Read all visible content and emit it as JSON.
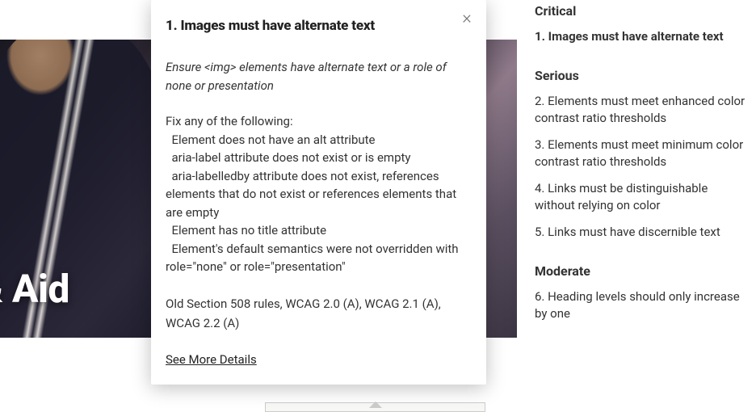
{
  "hero": {
    "title_fragment": "ns & Aid"
  },
  "popup": {
    "title": "1. Images must have alternate text",
    "intro": "Ensure <img> elements have alternate text or a role of none or presentation",
    "body": "Fix any of the following:\n  Element does not have an alt attribute\n  aria-label attribute does not exist or is empty\n  aria-labelledby attribute does not exist, references elements that do not exist or references elements that are empty\n  Element has no title attribute\n  Element's default semantics were not overridden with role=\"none\" or role=\"presentation\"",
    "rules": "Old Section 508 rules, WCAG 2.0 (A), WCAG 2.1 (A), WCAG 2.2 (A)",
    "link": "See More Details"
  },
  "sidebar": {
    "categories": [
      {
        "label": "Critical",
        "items": [
          {
            "text": "1. Images must have alternate text",
            "active": true
          }
        ]
      },
      {
        "label": "Serious",
        "items": [
          {
            "text": "2. Elements must meet enhanced color contrast ratio thresholds"
          },
          {
            "text": "3. Elements must meet minimum color contrast ratio thresholds"
          },
          {
            "text": "4. Links must be distinguishable without relying on color"
          },
          {
            "text": "5. Links must have discernible text"
          }
        ]
      },
      {
        "label": "Moderate",
        "items": [
          {
            "text": "6. Heading levels should only increase by one"
          }
        ]
      }
    ]
  }
}
